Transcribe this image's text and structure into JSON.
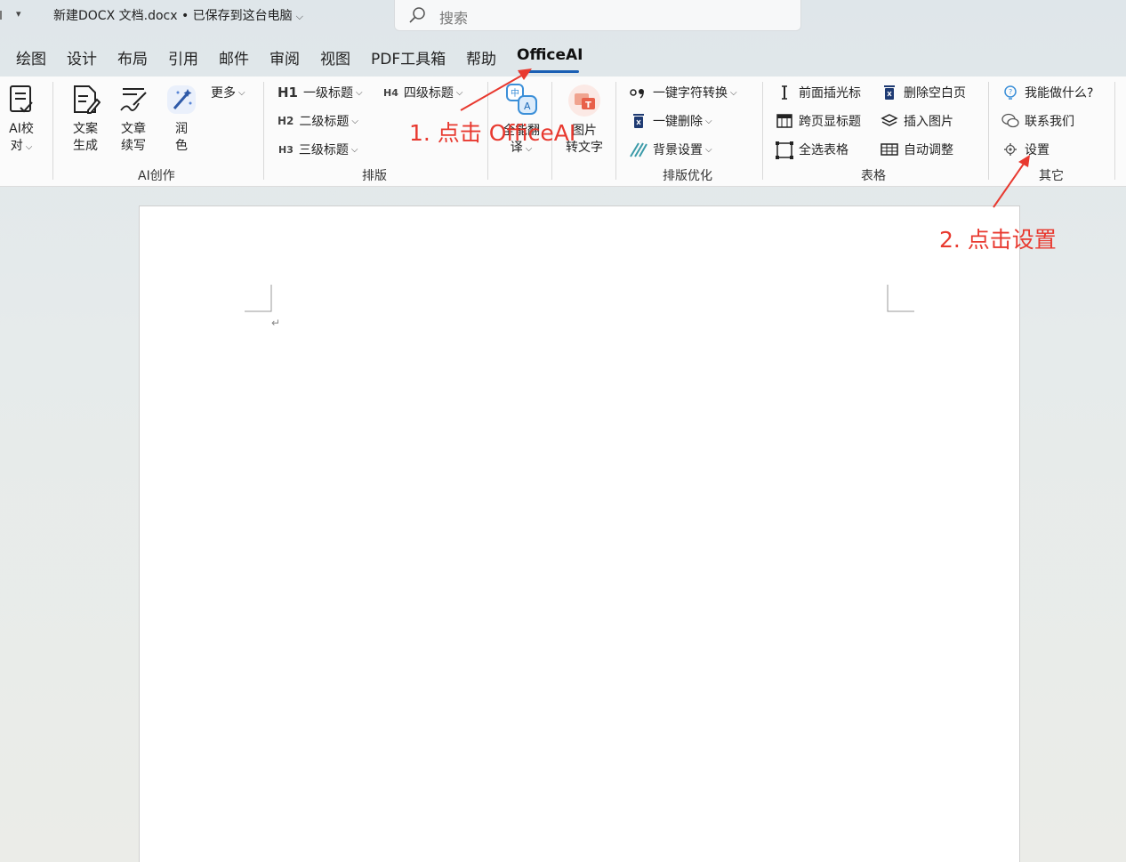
{
  "titlebar": {
    "doc_title": "新建DOCX 文档.docx • 已保存到这台电脑",
    "search_placeholder": "搜索"
  },
  "tabs": [
    "绘图",
    "设计",
    "布局",
    "引用",
    "邮件",
    "审阅",
    "视图",
    "PDF工具箱",
    "帮助",
    "OfficeAI"
  ],
  "active_tab": "OfficeAI",
  "ribbon": {
    "proof": {
      "line1": "AI校",
      "line2": "对"
    },
    "ai_create": {
      "copy_gen": {
        "line1": "文案",
        "line2": "生成"
      },
      "continue": {
        "line1": "文章",
        "line2": "续写"
      },
      "polish": {
        "line1": "润",
        "line2": "色"
      },
      "more": "更多",
      "label": "AI创作"
    },
    "layout": {
      "h1": {
        "tag": "H1",
        "label": "一级标题"
      },
      "h2": {
        "tag": "H2",
        "label": "二级标题"
      },
      "h3": {
        "tag": "H3",
        "label": "三级标题"
      },
      "h4": {
        "tag": "H4",
        "label": "四级标题"
      },
      "label": "排版"
    },
    "translate": {
      "line1": "全能翻",
      "line2": "译"
    },
    "image_text": {
      "line1": "图片",
      "line2": "转文字"
    },
    "layout_opt": {
      "convert": "一键字符转换",
      "delete": "一键删除",
      "background": "背景设置",
      "label": "排版优化"
    },
    "table": {
      "insert_cursor": "前面插光标",
      "cross_page_title": "跨页显标题",
      "select_all_cells": "全选表格",
      "delete_blank_page": "删除空白页",
      "insert_image": "插入图片",
      "auto_adjust": "自动调整",
      "label": "表格"
    },
    "other": {
      "what_can_i_do": "我能做什么?",
      "contact_us": "联系我们",
      "settings": "设置",
      "label": "其它"
    }
  },
  "annotations": {
    "step1": "1. 点击 OfficeAI",
    "step2": "2. 点击设置",
    "color": "#e8392f"
  },
  "colors": {
    "accent": "#1a5fb4",
    "icon_blue": "#2f5aa8"
  }
}
